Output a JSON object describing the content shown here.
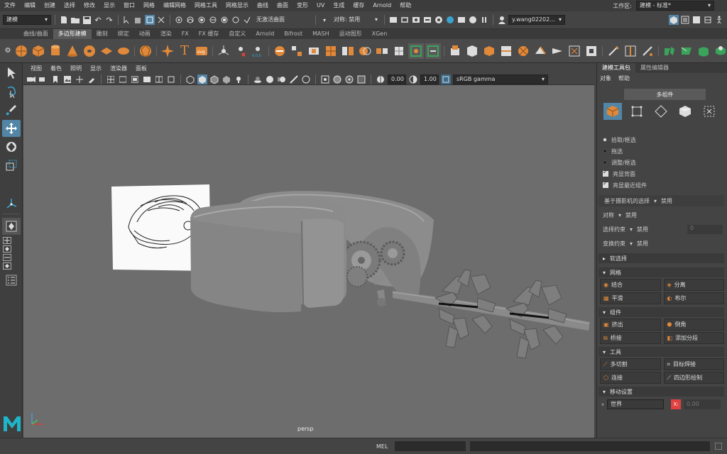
{
  "menubar": {
    "items": [
      "文件",
      "编辑",
      "创建",
      "选择",
      "修改",
      "显示",
      "窗口",
      "网格",
      "编辑网格",
      "网格工具",
      "网格显示",
      "曲线",
      "曲面",
      "变形",
      "UV",
      "生成",
      "缓存",
      "Arnold",
      "帮助"
    ],
    "workspace_label": "工作区:",
    "workspace_value": "建模 - 标准*"
  },
  "statusline": {
    "mode": "建模",
    "live_surface": "无激活曲面",
    "symmetry": "对称: 禁用",
    "user": "y.wang02202..."
  },
  "shelf_tabs": {
    "tabs": [
      "曲线/曲面",
      "多边形建模",
      "雕刻",
      "绑定",
      "动画",
      "渲染",
      "FX",
      "FX 缓存",
      "自定义",
      "Arnold",
      "Bifrost",
      "MASH",
      "运动图形",
      "XGen"
    ],
    "active": 1
  },
  "viewport": {
    "panel_menu": [
      "视图",
      "着色",
      "照明",
      "显示",
      "渲染器",
      "面板"
    ],
    "exposure": "0.00",
    "gamma": "1.00",
    "color_space": "sRGB gamma",
    "camera_label": "persp"
  },
  "right_panel": {
    "tabs": [
      "建模工具包",
      "属性编辑器"
    ],
    "menu": [
      "对象",
      "帮助"
    ],
    "multi_component": "多组件",
    "selection_modes": [
      "拾取/框选",
      "拖选",
      "调整/框选"
    ],
    "checks": [
      "亮显背面",
      "亮显最近组件"
    ],
    "camera_based": {
      "label": "基于摄影机的选择",
      "value": "禁用"
    },
    "symmetry": {
      "label": "对称",
      "value": "禁用"
    },
    "select_constraint": {
      "label": "选择约束",
      "value": "禁用",
      "num": "0"
    },
    "transform_constraint": {
      "label": "变换约束",
      "value": "禁用"
    },
    "soft_select": "软选择",
    "mesh_section": "网格",
    "mesh_buttons": [
      "结合",
      "分离",
      "平滑",
      "布尔"
    ],
    "component_section": "组件",
    "component_buttons": [
      "挤出",
      "倒角",
      "桥接",
      "添加分段"
    ],
    "tools_section": "工具",
    "tools_buttons": [
      "多切割",
      "目标焊接",
      "连接",
      "四边形绘制"
    ],
    "move_section": "移动设置",
    "space": "世界",
    "x_value": "0.00"
  },
  "bottom": {
    "mel_label": "MEL"
  },
  "colors": {
    "accent_orange": "#e0893a",
    "selection_blue": "#5285a6",
    "maya_logo": "#1fb5c9"
  }
}
